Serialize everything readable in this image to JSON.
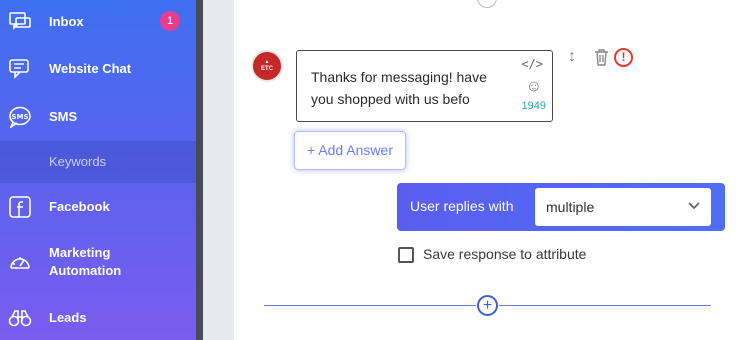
{
  "sidebar": {
    "items": [
      {
        "label": "Inbox",
        "icon": "chat-bubbles-icon",
        "badge": "1"
      },
      {
        "label": "Website Chat",
        "icon": "website-chat-icon"
      },
      {
        "label": "SMS",
        "icon": "sms-icon"
      },
      {
        "label": "Keywords",
        "icon": ""
      },
      {
        "label": "Facebook",
        "icon": "facebook-icon"
      },
      {
        "label": "Marketing Automation",
        "icon": "gauge-icon"
      },
      {
        "label": "Leads",
        "icon": "binoculars-icon"
      }
    ]
  },
  "message": {
    "avatar_text": "ETC",
    "text": "Thanks for messaging! have you shopped with us befo",
    "char_count": "1949"
  },
  "add_answer_label": "+ Add Answer",
  "reply": {
    "label": "User replies with",
    "selected": "multiple"
  },
  "save_response_label": "Save response to attribute",
  "colors": {
    "sidebar_top": "#3f6ff1",
    "sidebar_bottom": "#7a5cf0",
    "accent": "#5a5ef0",
    "badge": "#e83d8f",
    "error": "#e53935",
    "char_count": "#2aa9a1"
  }
}
